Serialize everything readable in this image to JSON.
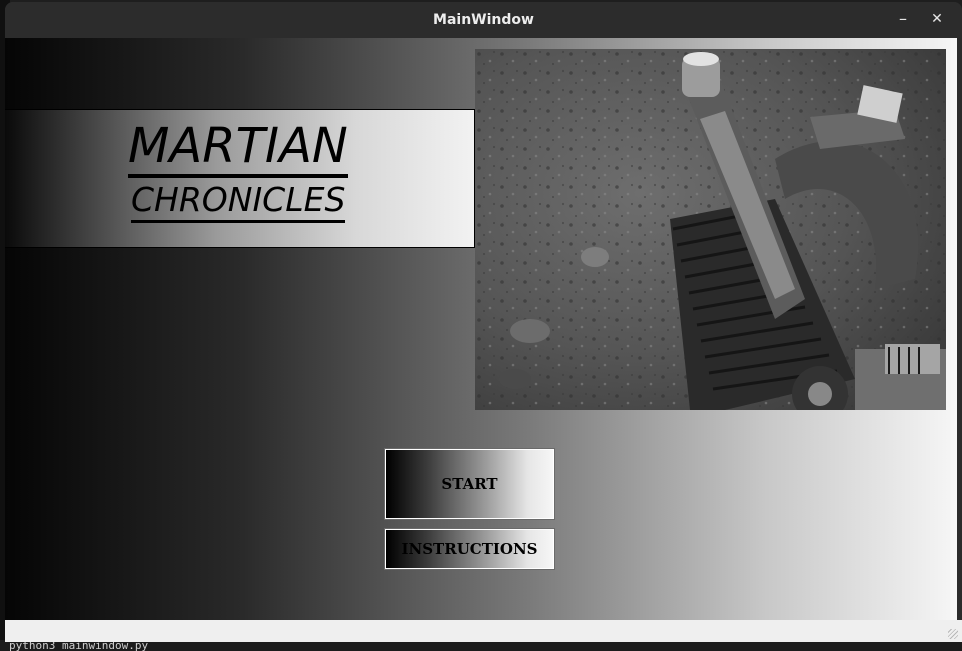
{
  "window": {
    "title": "MainWindow",
    "minimize_icon": "minimize-icon",
    "close_icon": "close-icon",
    "minimize_glyph": "–",
    "close_glyph": "✕"
  },
  "game": {
    "title_line1": "MARTIAN",
    "title_line2": "CHRONICLES"
  },
  "menu": {
    "start_label": "START",
    "instructions_label": "INSTRUCTIONS"
  },
  "terminal": {
    "command": "python3 mainwindow.py"
  },
  "colors": {
    "titlebar": "#2c2c2c",
    "gradient_dark": "#050505",
    "gradient_light": "#f6f6f6",
    "statusbar": "#efefef"
  }
}
